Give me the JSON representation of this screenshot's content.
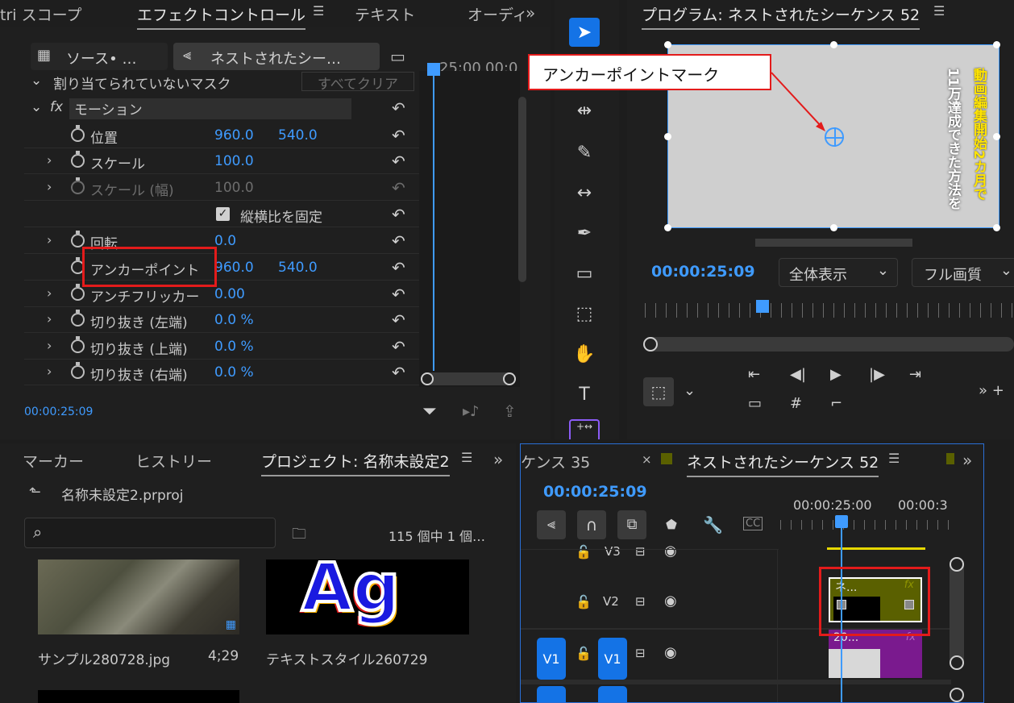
{
  "effect_panel": {
    "tabs": {
      "lumetri": "tri スコープ",
      "effect_controls": "エフェクトコントロール",
      "text": "テキスト",
      "audio": "オーディ"
    },
    "source_chip": "ソース• …",
    "sequence_chip": "ネストされたシー…",
    "timecode_header": "25;00",
    "timecode_header2": "00;0",
    "mask_row": "割り当てられていないマスク",
    "clear_all": "すべてクリア",
    "motion": "モーション",
    "rows": [
      {
        "label": "位置",
        "v1": "960.0",
        "v2": "540.0"
      },
      {
        "label": "スケール",
        "v1": "100.0",
        "v2": ""
      },
      {
        "label": "スケール (幅)",
        "v1": "100.0",
        "v2": ""
      },
      {
        "label": "縦横比を固定",
        "v1": "",
        "v2": ""
      },
      {
        "label": "回転",
        "v1": "0.0",
        "v2": ""
      },
      {
        "label": "アンカーポイント",
        "v1": "960.0",
        "v2": "540.0"
      },
      {
        "label": "アンチフリッカー",
        "v1": "0.00",
        "v2": ""
      },
      {
        "label": "切り抜き (左端)",
        "v1": "0.0 %",
        "v2": ""
      },
      {
        "label": "切り抜き (上端)",
        "v1": "0.0 %",
        "v2": ""
      },
      {
        "label": "切り抜き (右端)",
        "v1": "0.0 %",
        "v2": ""
      }
    ],
    "timecode": "00:00:25:09"
  },
  "program": {
    "title": "プログラム: ネストされたシーケンス 52",
    "timecode": "00:00:25:09",
    "zoom": "全体表示",
    "quality": "フル画質",
    "vertical_text_1": "動画編集開始2カ月で",
    "vertical_text_2": "11万達成できた方法を"
  },
  "annotation": {
    "label": "アンカーポイントマーク"
  },
  "project": {
    "tabs": {
      "markers": "マーカー",
      "history": "ヒストリー",
      "project": "プロジェクト: 名称未設定2"
    },
    "file": "名称未設定2.prproj",
    "count": "115 個中 1 個…",
    "items": [
      {
        "name": "サンプル280728.jpg",
        "duration": "4;29"
      },
      {
        "name": "テキストスタイル260729",
        "duration": ""
      }
    ],
    "thumb_text": "Ag"
  },
  "timeline": {
    "tab_prev": "ケンス 35",
    "tab_active": "ネストされたシーケンス 52",
    "timecode": "00:00:25:09",
    "ruler_1": "00:00:25:00",
    "ruler_2": "00:00:3",
    "tracks": {
      "v3": "V3",
      "v2": "V2",
      "v1": "V1",
      "v1_src": "V1"
    },
    "clip_v2": "ネ...",
    "clip_v1": "20...",
    "fx": "fx"
  }
}
